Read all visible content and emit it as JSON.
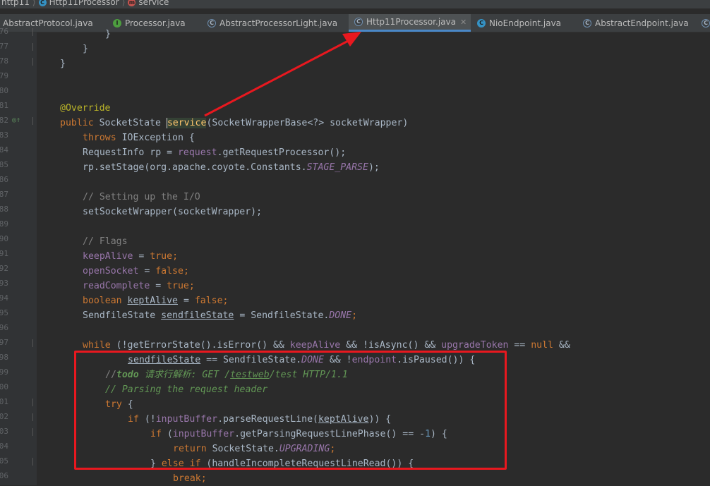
{
  "breadcrumb": {
    "items": [
      {
        "label": "http11",
        "icon": ""
      },
      {
        "label": "Http11Processor",
        "icon": "class-icon"
      },
      {
        "label": "service",
        "icon": "method-icon"
      }
    ]
  },
  "tabs": [
    {
      "label": "AbstractProtocol.java",
      "icon": "",
      "closable": false
    },
    {
      "label": "Processor.java",
      "icon": "interface-icon",
      "closable": false
    },
    {
      "label": "AbstractProcessorLight.java",
      "icon": "abstract-class-icon",
      "closable": false
    },
    {
      "label": "Http11Processor.java",
      "icon": "class-icon",
      "closable": true,
      "active": true
    },
    {
      "label": "NioEndpoint.java",
      "icon": "class-icon",
      "closable": false
    },
    {
      "label": "AbstractEndpoint.java",
      "icon": "abstract-class-icon",
      "closable": false
    }
  ],
  "gutter": {
    "line_numbers": [
      "76",
      "77",
      "78",
      "79",
      "80",
      "81",
      "82",
      "83",
      "84",
      "85",
      "86",
      "87",
      "88",
      "89",
      "90",
      "91",
      "92",
      "93",
      "94",
      "95",
      "96",
      "97",
      "98",
      "99",
      "100",
      "101",
      "102",
      "103",
      "104",
      "105",
      "106"
    ]
  },
  "code": {
    "l76": "}",
    "l77": "}",
    "l81": "@Override",
    "l82_a": "public",
    "l82_b": " SocketState ",
    "l82_c": "service",
    "l82_d": "(SocketWrapperBase<?> socketWrapper)",
    "l83_a": "throws",
    "l83_b": " IOException {",
    "l84_a": "RequestInfo rp = ",
    "l84_b": "request",
    "l84_c": ".getRequestProcessor();",
    "l85_a": "rp.setStage(org.apache.coyote.Constants.",
    "l85_b": "STAGE_PARSE",
    "l85_c": ");",
    "l87": "// Setting up the I/O",
    "l88": "setSocketWrapper(socketWrapper);",
    "l90": "// Flags",
    "l91_a": "keepAlive",
    "l91_b": " = ",
    "l91_c": "true",
    "l91_d": ";",
    "l92_a": "openSocket",
    "l92_b": " = ",
    "l92_c": "false",
    "l92_d": ";",
    "l93_a": "readComplete",
    "l93_b": " = ",
    "l93_c": "true",
    "l93_d": ";",
    "l94_a": "boolean",
    "l94_b": "keptAlive",
    "l94_c": " = ",
    "l94_d": "false",
    "l94_e": ";",
    "l95_a": "SendfileState ",
    "l95_b": "sendfileState",
    "l95_c": " = SendfileState.",
    "l95_d": "DONE",
    "l95_e": ";",
    "l97_a": "while",
    "l97_b": " (!getErrorState().isError() && ",
    "l97_c": "keepAlive",
    "l97_d": " && !isAsync() && ",
    "l97_e": "upgradeToken",
    "l97_f": " == ",
    "l97_g": "null",
    "l97_h": " &&",
    "l98_a": "sendfileState",
    "l98_b": " == SendfileState.",
    "l98_c": "DONE",
    "l98_d": " && !",
    "l98_e": "endpoint",
    "l98_f": ".isPaused()) {",
    "l99_a": "//",
    "l99_b": "todo ",
    "l99_c": "请求行解析: GET /",
    "l99_d": "testweb",
    "l99_e": "/test HTTP/1.1",
    "l100": "// Parsing the request header",
    "l101_a": "try",
    "l101_b": " {",
    "l102_a": "if",
    "l102_b": " (!",
    "l102_c": "inputBuffer",
    "l102_d": ".parseRequestLine(",
    "l102_e": "keptAlive",
    "l102_f": ")) {",
    "l103_a": "if",
    "l103_b": " (",
    "l103_c": "inputBuffer",
    "l103_d": ".getParsingRequestLinePhase() == -",
    "l103_e": "1",
    "l103_f": ") {",
    "l104_a": "return",
    "l104_b": " SocketState.",
    "l104_c": "UPGRADING",
    "l104_d": ";",
    "l105_a": "} ",
    "l105_b": "else if",
    "l105_c": " (handleIncompleteRequestLineRead()) {",
    "l106_a": "break",
    "l106_b": ";"
  },
  "colors": {
    "editor_bg": "#2b2b2b",
    "keyword": "#cc7832",
    "annotation": "#bbb529",
    "field": "#9876aa",
    "comment": "#808080",
    "todo": "#629755",
    "annotation_red": "#e8181f"
  }
}
